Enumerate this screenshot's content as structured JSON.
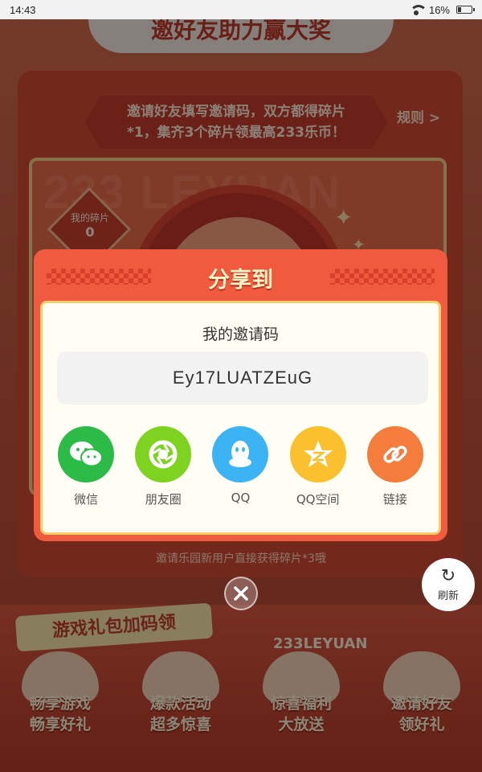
{
  "status_bar": {
    "time": "14:43",
    "battery": "16%"
  },
  "page": {
    "banner_title": "邀好友助力赢大奖",
    "tip_line1": "邀请好友填写邀请码，双方都得碎片",
    "tip_line2": "*1，集齐3个碎片领最高233乐币！",
    "rules_label": "规则 >",
    "bg_letters": "233 LEYUAN",
    "fragment_label": "我的碎片",
    "fragment_count": "0",
    "under_hint": "邀请乐园新用户直接获得碎片*3哦",
    "gift_tag": "游戏礼包加码领",
    "logo_text": "233LEYUAN",
    "features": [
      {
        "line1": "畅享游戏",
        "line2": "畅享好礼"
      },
      {
        "line1": "爆款活动",
        "line2": "超多惊喜"
      },
      {
        "line1": "惊喜福利",
        "line2": "大放送"
      },
      {
        "line1": "邀请好友",
        "line2": "领好礼"
      }
    ]
  },
  "refresh": {
    "label": "刷新",
    "icon": "refresh-icon"
  },
  "modal": {
    "title": "分享到",
    "code_label": "我的邀请码",
    "invite_code": "Ey17LUATZEuG",
    "share_options": [
      {
        "label": "微信",
        "icon": "wechat-icon",
        "color": "#2dbb47"
      },
      {
        "label": "朋友圈",
        "icon": "moments-icon",
        "color": "#7ed321"
      },
      {
        "label": "QQ",
        "icon": "qq-icon",
        "color": "#3cb4f4"
      },
      {
        "label": "QQ空间",
        "icon": "qzone-icon",
        "color": "#fbc02d"
      },
      {
        "label": "链接",
        "icon": "link-icon",
        "color": "#f47c3c"
      }
    ]
  },
  "close": {
    "icon": "close-icon"
  }
}
